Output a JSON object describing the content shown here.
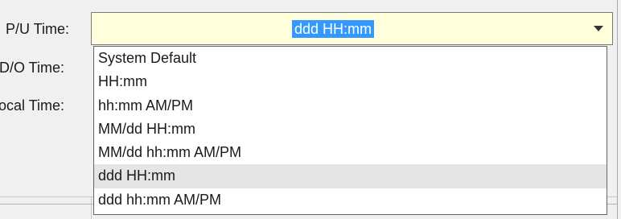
{
  "labels": {
    "pickup_time": "P/U Time:",
    "dropoff_time": "D/O Time:",
    "local_time": "ocal Time:"
  },
  "combo": {
    "value": "ddd HH:mm"
  },
  "dropdown": {
    "options": [
      "System Default",
      "HH:mm",
      "hh:mm AM/PM",
      "MM/dd HH:mm",
      "MM/dd hh:mm AM/PM",
      "ddd HH:mm",
      "ddd hh:mm AM/PM"
    ],
    "selected_index": 5
  },
  "icons": {
    "combo_arrow": "chevron-down-icon"
  }
}
